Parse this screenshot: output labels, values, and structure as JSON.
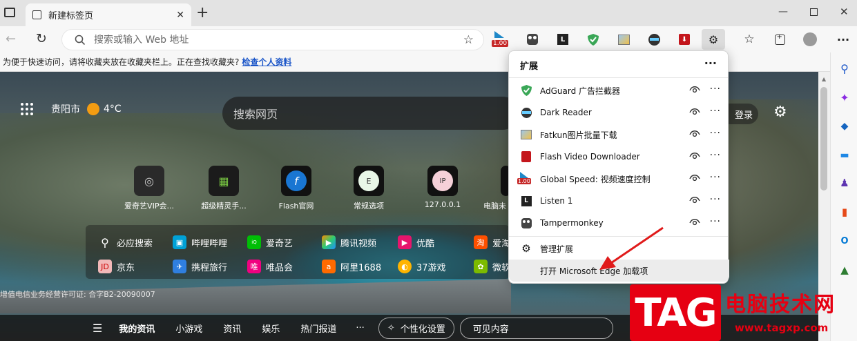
{
  "tab": {
    "title": "新建标签页"
  },
  "address": {
    "placeholder": "搜索或输入 Web 地址"
  },
  "toolbar": {
    "badge": "1.00"
  },
  "favbar": {
    "message": "为便于快速访问，请将收藏夹放在收藏夹栏上。正在查找收藏夹?",
    "link": "检查个人资料"
  },
  "newtab": {
    "city": "贵阳市",
    "temp": "4°C",
    "search_placeholder": "搜索网页",
    "login": "登录",
    "tiles": [
      {
        "label": "爱奇艺VIP会..."
      },
      {
        "label": "超级精灵手..."
      },
      {
        "label": "Flash官网"
      },
      {
        "label": "常规选项",
        "glyph": "E"
      },
      {
        "label": "127.0.0.1",
        "glyph": "IP"
      },
      {
        "label": "电脑未"
      }
    ],
    "links_row1": [
      "必应搜索",
      "哔哩哔哩",
      "爱奇艺",
      "腾讯视频",
      "优酷",
      "爱淘"
    ],
    "links_row2": [
      "京东",
      "携程旅行",
      "唯品会",
      "阿里1688",
      "37游戏",
      "微软"
    ],
    "icp": "增值电信业务经营许可证: 合字B2-20090007",
    "bottom_nav": [
      "我的资讯",
      "小游戏",
      "资讯",
      "娱乐",
      "热门报道",
      "···",
      "个性化设置",
      "可见内容"
    ]
  },
  "extensions": {
    "title": "扩展",
    "items": [
      {
        "name": "AdGuard 广告拦截器"
      },
      {
        "name": "Dark Reader"
      },
      {
        "name": "Fatkun图片批量下载"
      },
      {
        "name": "Flash Video Downloader"
      },
      {
        "name": "Global Speed: 视频速度控制"
      },
      {
        "name": "Listen 1"
      },
      {
        "name": "Tampermonkey"
      }
    ],
    "manage": "管理扩展",
    "open_addons": "打开 Microsoft Edge 加载项"
  },
  "watermark": {
    "tag": "TAG",
    "cn": "电脑技术网",
    "url": "www.tagxp.com"
  },
  "colors": {
    "accent": "#1a55c8",
    "watermark_red": "#e60012",
    "arrow_red": "#e01a1a"
  }
}
